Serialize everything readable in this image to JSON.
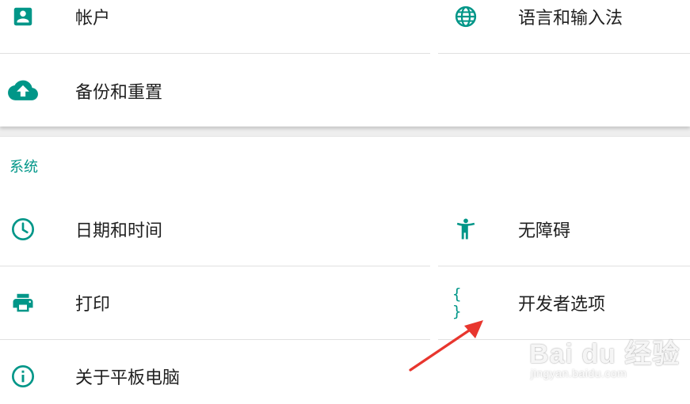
{
  "colors": {
    "accent": "#009688",
    "text": "#212121",
    "divider": "#e0e0e0",
    "arrow": "#e8362e"
  },
  "personal": {
    "items": [
      {
        "label": "帐户",
        "icon": "account-box-icon"
      },
      {
        "label": "语言和输入法",
        "icon": "globe-icon"
      },
      {
        "label": "备份和重置",
        "icon": "cloud-upload-icon"
      }
    ]
  },
  "system": {
    "title": "系统",
    "items": [
      {
        "label": "日期和时间",
        "icon": "clock-icon"
      },
      {
        "label": "无障碍",
        "icon": "accessibility-icon"
      },
      {
        "label": "打印",
        "icon": "printer-icon"
      },
      {
        "label": "开发者选项",
        "icon": "code-braces-icon",
        "glyph": "{ }"
      },
      {
        "label": "关于平板电脑",
        "icon": "info-icon"
      }
    ]
  },
  "watermark": {
    "logo": "Bai du 经验",
    "url": "jingyan.baidu.com"
  }
}
